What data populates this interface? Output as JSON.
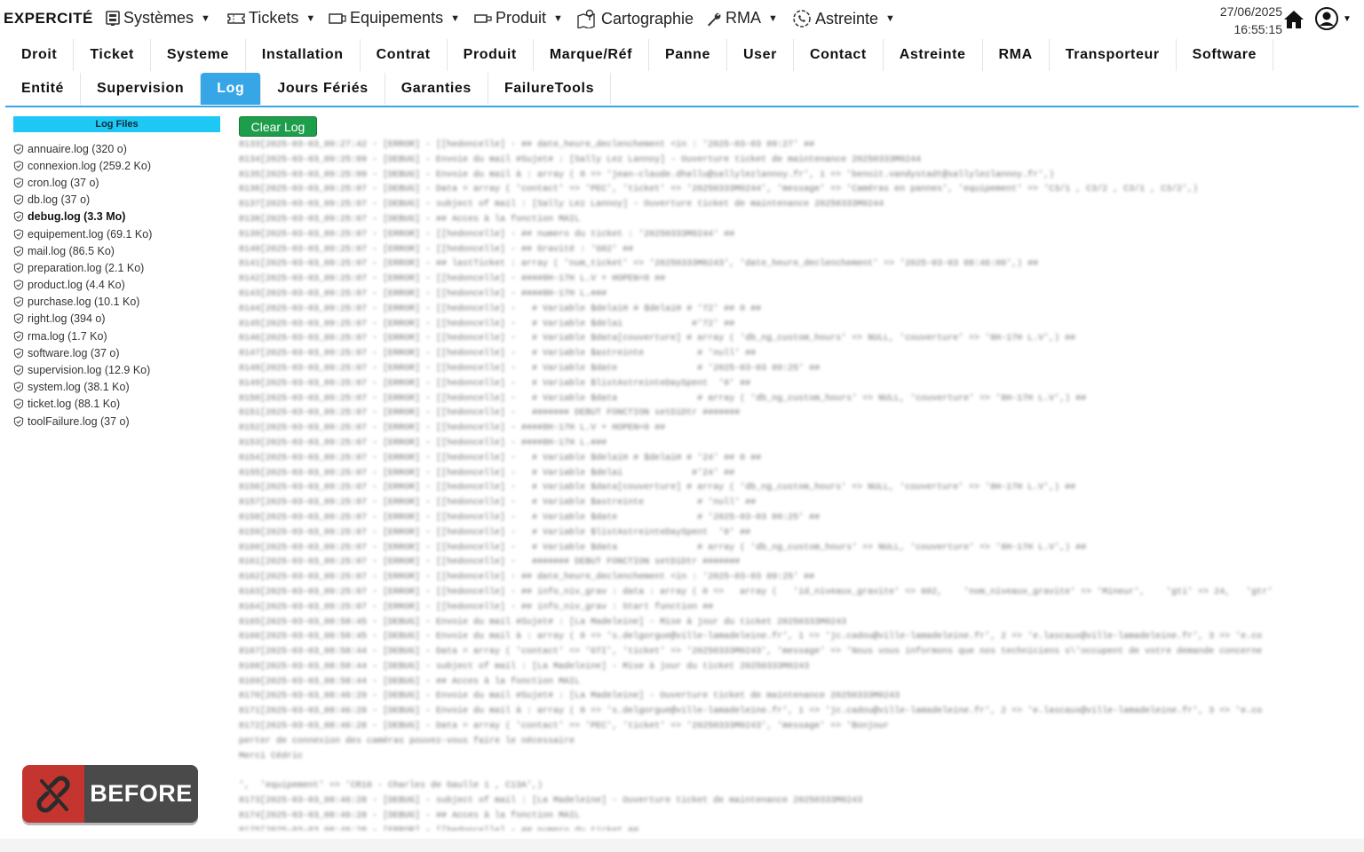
{
  "app": {
    "logo": "EXPERCITÉ",
    "date": "27/06/2025",
    "time": "16:55:15",
    "accent_color": "#37a6e6"
  },
  "topmenu": [
    {
      "label": "Systèmes",
      "icon": "server-icon",
      "has_caret": true
    },
    {
      "label": "Tickets",
      "icon": "ticket-icon",
      "has_caret": true
    },
    {
      "label": "Equipements",
      "icon": "screen-icon",
      "has_caret": true
    },
    {
      "label": "Produit",
      "icon": "product-icon",
      "has_caret": true
    },
    {
      "label": "Cartographie",
      "icon": "map-icon",
      "has_caret": false
    },
    {
      "label": "RMA",
      "icon": "wrench-icon",
      "has_caret": true
    },
    {
      "label": "Astreinte",
      "icon": "phone-clock-icon",
      "has_caret": true
    }
  ],
  "tabs_row1": [
    "Droit",
    "Ticket",
    "Systeme",
    "Installation",
    "Contrat",
    "Produit",
    "Marque/Réf",
    "Panne",
    "User",
    "Contact",
    "Astreinte",
    "RMA",
    "Transporteur",
    "Software"
  ],
  "tabs_row2": [
    "Entité",
    "Supervision",
    "Log",
    "Jours Fériés",
    "Garanties",
    "FailureTools"
  ],
  "active_tab": "Log",
  "log_files": {
    "title": "Log Files",
    "items": [
      {
        "label": "annuaire.log (320 o)",
        "selected": false
      },
      {
        "label": "connexion.log (259.2 Ko)",
        "selected": false
      },
      {
        "label": "cron.log (37 o)",
        "selected": false
      },
      {
        "label": "db.log (37 o)",
        "selected": false
      },
      {
        "label": "debug.log (3.3 Mo)",
        "selected": true
      },
      {
        "label": "equipement.log (69.1 Ko)",
        "selected": false
      },
      {
        "label": "mail.log (86.5 Ko)",
        "selected": false
      },
      {
        "label": "preparation.log (2.1 Ko)",
        "selected": false
      },
      {
        "label": "product.log (4.4 Ko)",
        "selected": false
      },
      {
        "label": "purchase.log (10.1 Ko)",
        "selected": false
      },
      {
        "label": "right.log (394 o)",
        "selected": false
      },
      {
        "label": "rma.log (1.7 Ko)",
        "selected": false
      },
      {
        "label": "software.log (37 o)",
        "selected": false
      },
      {
        "label": "supervision.log (12.9 Ko)",
        "selected": false
      },
      {
        "label": "system.log (38.1 Ko)",
        "selected": false
      },
      {
        "label": "ticket.log (88.1 Ko)",
        "selected": false
      },
      {
        "label": "toolFailure.log (37 o)",
        "selected": false
      }
    ]
  },
  "clear_button": "Clear Log",
  "log_lines": [
    "8133[2025-03-03_09:27:42 - [ERROR] - [[hedoncelle] - ## date_heure_declenchement <in : '2025-03-03 09:27' ##",
    "8134[2025-03-03_09:25:09 - [DEBUG] - Envoie du mail #Sujet# : [Sally Lez Lannoy] - Ouverture ticket de maintenance 20250333M0244",
    "8135[2025-03-03_09:25:09 - [DEBUG] - Envoie du mail à : array ( 0 => 'jean-claude.dhallu@sallylezlannoy.fr', 1 => 'benoit.vandystadt@sallylezlannoy.fr',)",
    "8136[2025-03-03_09:25:07 - [DEBUG] - Data = array ( 'contact' => 'PEC', 'ticket' => '20250333M0244', 'message' => 'Caméras en pannes', 'equipement' => 'C3/1 , C3/2 , C3/1 , C3/2',)",
    "8137[2025-03-03_09:25:07 - [DEBUG] - subject of mail : [Sally Lez Lannoy] - Ouverture ticket de maintenance 20250333M0244",
    "8138[2025-03-03_09:25:07 - [DEBUG] - ## Acces à la fonction MAIL",
    "8139[2025-03-03_09:25:07 - [ERROR] - [[hedoncelle] - ## numero du ticket : '20250333M0244' ##",
    "8140[2025-03-03_09:25:07 - [ERROR] - [[hedoncelle] - ## Gravité : 'G02' ##",
    "8141[2025-03-03_09:25:07 - [ERROR] - ## lastTicket : array ( 'num_ticket' => '20250333M0243', 'date_heure_declenchement' => '2025-03-03 08:46:00',) ##",
    "8142[2025-03-03_09:25:07 - [ERROR] - [[hedoncelle] - ####8H-17H L.V + HOPEN=0 ##",
    "8143[2025-03-03_09:25:07 - [ERROR] - [[hedoncelle] - ####8H-17H L.###",
    "8144[2025-03-03_09:25:07 - [ERROR] - [[hedoncelle] -   # Variable $delaiH # $delaiH # '72' ## 0 ##",
    "8145[2025-03-03_09:25:07 - [ERROR] - [[hedoncelle] -   # Variable $delai             #'72' ##",
    "8146[2025-03-03_09:25:07 - [ERROR] - [[hedoncelle] -   # Variable $data[couverture] # array ( 'db_ng_custom_hours' => NULL, 'couverture' => '8H-17H L.V',) ##",
    "8147[2025-03-03_09:25:07 - [ERROR] - [[hedoncelle] -   # Variable $astreinte          # 'null' ##",
    "8148[2025-03-03_09:25:07 - [ERROR] - [[hedoncelle] -   # Variable $date               # '2025-03-03 09:25' ##",
    "8149[2025-03-03_09:25:07 - [ERROR] - [[hedoncelle] -   # Variable $listAstreinteDaySpent  '0' ##",
    "8150[2025-03-03_09:25:07 - [ERROR] - [[hedoncelle] -   # Variable $data               # array ( 'db_ng_custom_hours' => NULL, 'couverture' => '8H-17H L.V',) ##",
    "8151[2025-03-03_09:25:07 - [ERROR] - [[hedoncelle] -   ####### DEBUT FONCTION setDiDtr #######",
    "8152[2025-03-03_09:25:07 - [ERROR] - [[hedoncelle] - ####8H-17H L.V + HOPEN=0 ##",
    "8153[2025-03-03_09:25:07 - [ERROR] - [[hedoncelle] - ####8H-17H L.###",
    "8154[2025-03-03_09:25:07 - [ERROR] - [[hedoncelle] -   # Variable $delaiH # $delaiH # '24' ## 0 ##",
    "8155[2025-03-03_09:25:07 - [ERROR] - [[hedoncelle] -   # Variable $delai             #'24' ##",
    "8156[2025-03-03_09:25:07 - [ERROR] - [[hedoncelle] -   # Variable $data[couverture] # array ( 'db_ng_custom_hours' => NULL, 'couverture' => '8H-17H L.V',) ##",
    "8157[2025-03-03_09:25:07 - [ERROR] - [[hedoncelle] -   # Variable $astreinte          # 'null' ##",
    "8158[2025-03-03_09:25:07 - [ERROR] - [[hedoncelle] -   # Variable $date               # '2025-03-03 09:25' ##",
    "8159[2025-03-03_09:25:07 - [ERROR] - [[hedoncelle] -   # Variable $listAstreinteDaySpent  '0' ##",
    "8160[2025-03-03_09:25:07 - [ERROR] - [[hedoncelle] -   # Variable $data               # array ( 'db_ng_custom_hours' => NULL, 'couverture' => '8H-17H L.V',) ##",
    "8161[2025-03-03_09:25:07 - [ERROR] - [[hedoncelle] -   ####### DEBUT FONCTION setDiDtr #######",
    "8162[2025-03-03_09:25:07 - [ERROR] - [[hedoncelle] - ## date_heure_declenchement <in : '2025-03-03 09:25' ##",
    "8163[2025-03-03_09:25:07 - [ERROR] - [[hedoncelle] - ## info_niv_grav : data : array ( 0 =>   array (   'id_niveaux_gravite' => 602,    'nom_niveaux_gravite' => 'Mineur',    'gti' => 24,   'gtr'",
    "8164[2025-03-03_09:25:07 - [ERROR] - [[hedoncelle] - ## info_niv_grav : Start function ##",
    "8165[2025-03-03_08:58:45 - [DEBUG] - Envoie du mail #Sujet# : [La Madeleine] - Mise à jour du ticket 20250333M0243",
    "8166[2025-03-03_08:58:45 - [DEBUG] - Envoie du mail à : array ( 0 => 's.delgorgue@ville-lamadeleine.fr', 1 => 'jc.cadou@ville-lamadeleine.fr', 2 => 'e.lascaux@ville-lamadeleine.fr', 3 => 'e.co",
    "8167[2025-03-03_08:58:44 - [DEBUG] - Data = array ( 'contact' => 'GTI', 'ticket' => '20250333M0243', 'message' => 'Nous vous informons que nos techniciens s\\'occupent de votre demande concerne",
    "8168[2025-03-03_08:58:44 - [DEBUG] - subject of mail : [La Madeleine] - Mise à jour du ticket 20250333M0243",
    "8169[2025-03-03_08:58:44 - [DEBUG] - ## Acces à la fonction MAIL",
    "8170[2025-03-03_08:46:29 - [DEBUG] - Envoie du mail #Sujet# : [La Madeleine] - Ouverture ticket de maintenance 20250333M0243",
    "8171[2025-03-03_08:46:28 - [DEBUG] - Envoie du mail à : array ( 0 => 's.delgorgue@ville-lamadeleine.fr', 1 => 'jc.cadou@ville-lamadeleine.fr', 2 => 'e.lascaux@ville-lamadeleine.fr', 3 => 'e.co",
    "8172[2025-03-03_08:46:28 - [DEBUG] - Data = array ( 'contact' => 'PEC', 'ticket' => '20250333M0243', 'message' => 'Bonjour",
    "perter de connexion des caméras pouvez-vous faire le nécessaire",
    "Merci Cédric",
    "",
    "',  'equipement' => 'CR16 - Charles de Gaulle 1 , C13A',)",
    "8173[2025-03-03_08:46:28 - [DEBUG] - subject of mail : [La Madeleine] - Ouverture ticket de maintenance 20250333M0243",
    "8174[2025-03-03_08:46:28 - [DEBUG] - ## Acces à la fonction MAIL",
    "8175[2025-03-03_08:46:28 - [ERROR] - [[hedoncelle] - ## numero du ticket ##"
  ],
  "badge": {
    "label": "BEFORE",
    "icon": "broken-link-icon",
    "color": "#c5352f"
  }
}
